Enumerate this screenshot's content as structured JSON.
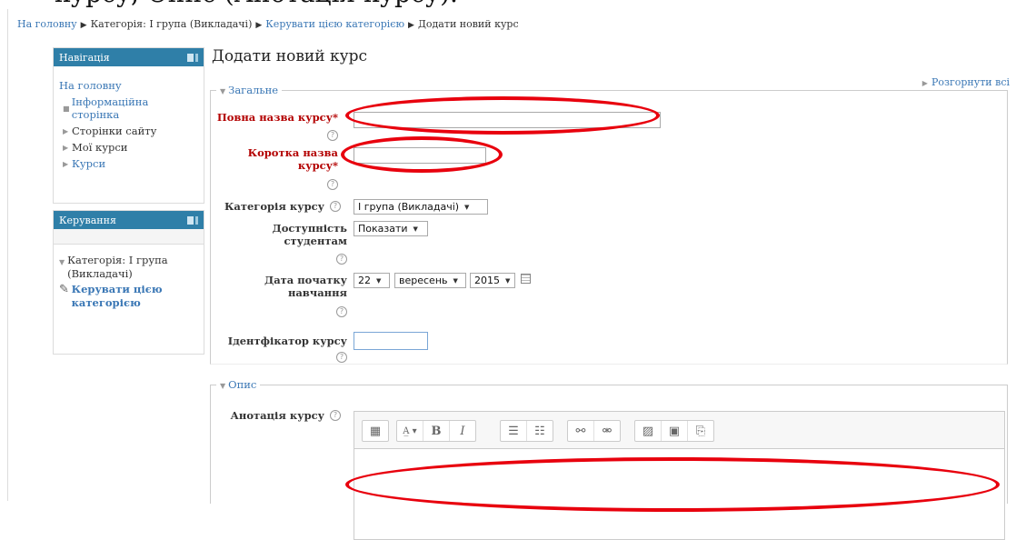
{
  "breadcrumb": {
    "items": [
      "На головну",
      "Категорія: І група (Викладачі)",
      "Керувати цією категорією",
      "Додати новий курс"
    ]
  },
  "navigation_block": {
    "title": "Навігація",
    "root": "На головну",
    "items": [
      "Інформаційна сторінка",
      "Сторінки сайту",
      "Мої курси",
      "Курси"
    ]
  },
  "admin_block": {
    "title": "Керування",
    "category": "Категорія: І група (Викладачі)",
    "manage_link": "Керувати цією категорією"
  },
  "page_title": "Додати новий курс",
  "expand_all": "Розгорнути всі",
  "general": {
    "legend": "Загальне",
    "fullname_label": "Повна назва курсу",
    "shortname_label": "Коротка назва курсу",
    "category_label": "Категорія курсу",
    "category_value": "І група (Викладачі)",
    "visibility_label": "Доступність студентам",
    "visibility_value": "Показати",
    "startdate_label": "Дата початку навчання",
    "day": "22",
    "month": "вересень",
    "year": "2015",
    "idnumber_label": "Ідентфікатор курсу"
  },
  "description": {
    "legend": "Опис",
    "summary_label": "Анотація курсу"
  },
  "colors": {
    "block_header": "#2f7fa8",
    "link": "#3a77b5",
    "required": "#b30000",
    "annotation": "#e8000d"
  }
}
